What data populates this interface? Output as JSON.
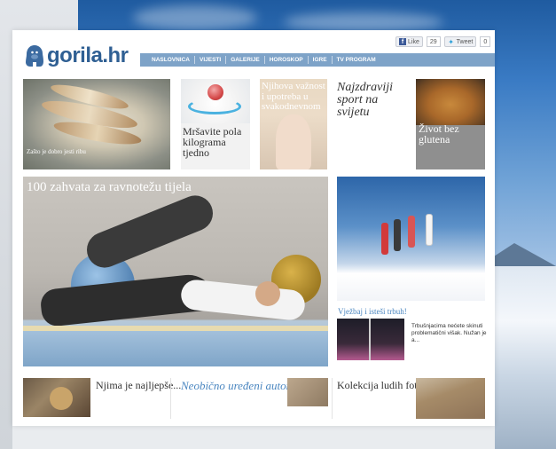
{
  "brand": {
    "name": "gorila.hr",
    "color": "#2f5f93"
  },
  "social": {
    "like_label": "Like",
    "like_count": "29",
    "tweet_label": "Tweet",
    "tweet_count": "0"
  },
  "nav": {
    "items": [
      {
        "label": "NASLOVNICA"
      },
      {
        "label": "VIJESTI"
      },
      {
        "label": "GALERIJE"
      },
      {
        "label": "HOROSKOP"
      },
      {
        "label": "IGRE"
      },
      {
        "label": "TV PROGRAM"
      }
    ],
    "bg_color": "#7ea3c8"
  },
  "top_tiles": [
    {
      "caption": "Zašto je dobro jesti ribu"
    },
    {
      "caption": "Mršavite pola kilograma tjedno"
    },
    {
      "caption": "Njihova važnost i upotreba u svakodnevnom"
    },
    {
      "caption": "Najzdraviji sport na svijetu"
    },
    {
      "caption": "Život bez glutena"
    }
  ],
  "feature": {
    "title": "100 zahvata za ravnotežu tijela"
  },
  "promo": {
    "title": "Vježbaj i isteši trbuh!",
    "text": "Trbušnjacima nećete skinuti problematični višak. Nužan je a..."
  },
  "bottom_row": [
    {
      "caption": "Njima je najljepše..."
    },
    {
      "caption": "Neobično uređeni automobili"
    },
    {
      "caption": "Kolekcija ludih fotki..."
    }
  ],
  "accent_color": "#4a86c0"
}
